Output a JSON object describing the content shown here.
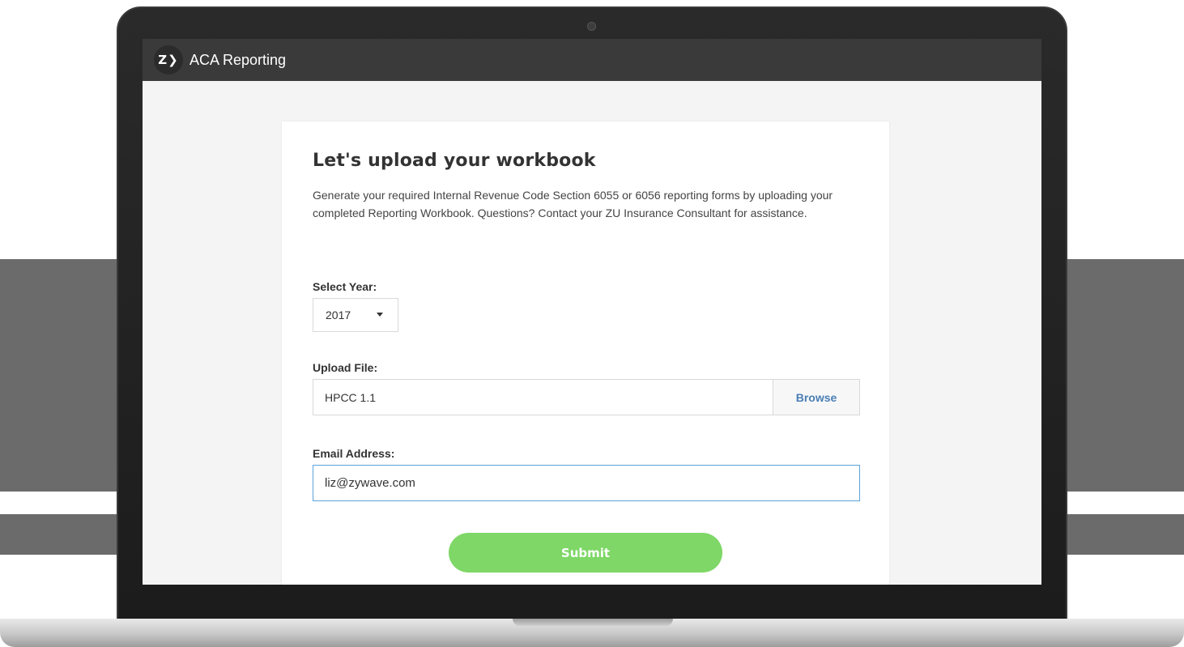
{
  "header": {
    "logo_text": "Z❯",
    "title": "ACA Reporting"
  },
  "card": {
    "title": "Let's upload your workbook",
    "description": "Generate your required Internal Revenue Code Section 6055 or 6056 reporting forms by uploading your completed Reporting Workbook. Questions? Contact your ZU Insurance Consultant for assistance."
  },
  "form": {
    "year_label": "Select Year:",
    "year_value": "2017",
    "file_label": "Upload File:",
    "file_value": "HPCC 1.1",
    "browse_label": "Browse",
    "email_label": "Email Address:",
    "email_value": "liz@zywave.com",
    "submit_label": "Submit"
  },
  "colors": {
    "header_bg": "#3a3a3a",
    "submit_bg": "#7ed766",
    "browse_text": "#4a7fb5",
    "focus_border": "#5aa3dc"
  },
  "icons": {
    "dropdown": "caret-down-icon"
  }
}
